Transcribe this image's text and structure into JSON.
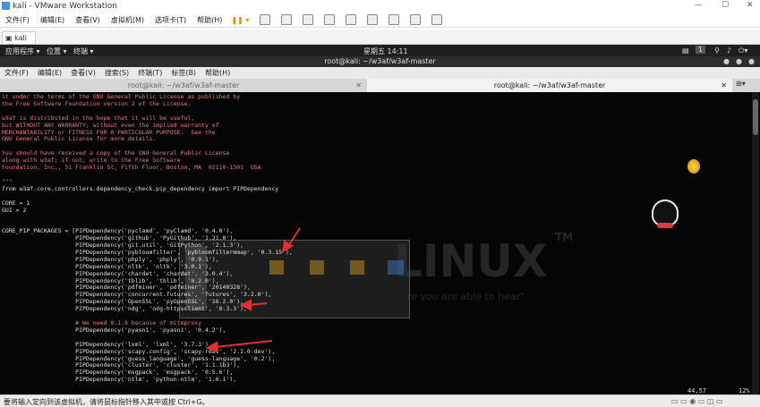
{
  "app": {
    "title": "kali - VMware Workstation"
  },
  "menubar": [
    "文件(F)",
    "编辑(E)",
    "查看(V)",
    "虚拟机(M)",
    "选项卡(T)",
    "帮助(H)"
  ],
  "tab": {
    "label": "kali"
  },
  "gnome": {
    "apps": "应用程序 ▾",
    "places": "位置 ▾",
    "terminal": "终端 ▾",
    "clock": "星期五 14:11",
    "workspace": "1"
  },
  "terminal": {
    "title": "root@kali: ~/w3af/w3af-master",
    "menu": [
      "文件(F)",
      "编辑(E)",
      "查看(V)",
      "搜索(S)",
      "终端(T)",
      "标签(B)",
      "帮助(H)"
    ],
    "tab1": "root@kali: ~/w3af/w3af-master",
    "tab2": "root@kali: ~/w3af/w3af-master",
    "position": "44,57",
    "percent": "12%"
  },
  "code_lines": [
    "it under the terms of the GNU General Public License as published by",
    "the Free Software Foundation version 2 of the License.",
    "",
    "w3af is distributed in the hope that it will be useful,",
    "but WITHOUT ANY WARRANTY; without even the implied warranty of",
    "MERCHANTABILITY or FITNESS FOR A PARTICULAR PURPOSE.  See the",
    "GNU General Public License for more details.",
    "",
    "You should have received a copy of the GNU General Public License",
    "along with w3af; if not, write to the Free Software",
    "Foundation, Inc., 51 Franklin St, Fifth Floor, Boston, MA  02110-1301  USA",
    "",
    "\"\"\"",
    "from w3af.core.controllers.dependency_check.pip_dependency import PIPDependency",
    "",
    "CORE = 1",
    "GUI = 2",
    "",
    "",
    "CORE_PIP_PACKAGES = [PIPDependency('pyclamd', 'pyClamd', '0.4.0'),",
    "                     PIPDependency('github', 'PyGithub', '1.21.0'),",
    "                     PIPDependency('git.util', 'GitPython', '2.1.3'),",
    "                     PIPDependency('pybloomfilter', 'pybloomfiltermmap', '0.3.15'),",
    "                     PIPDependency('phply', 'phply', '0.9.1'),",
    "                     PIPDependency('nltk', 'nltk', '3.0.1'),",
    "                     PIPDependency('chardet', 'chardet', '3.0.4'),",
    "                     PIPDependency('tblib', 'tblib', '0.2.0'),",
    "                     PIPDependency('pdfminer', 'pdfminer', '20140328'),",
    "                     PIPDependency('concurrent.futures', 'futures', '3.2.0'),",
    "                     PIPDependency('OpenSSL', 'pyOpenSSL', '16.2.0'),",
    "                     PIPDependency('ndg', 'ndg-httpsclient', '0.3.3'),",
    "",
    "                     # We need 0.1.8 because of mitmproxy",
    "                     PIPDependency('pyasn1', 'pyasn1', '0.4.2'),",
    "",
    "                     PIPDependency('lxml', 'lxml', '3.7.3'),",
    "                     PIPDependency('scapy.config', 'scapy-real', '2.2.0-dev'),",
    "                     PIPDependency('guess_language', 'guess-language', '0.2'),",
    "                     PIPDependency('cluster', 'cluster', '1.1.1b3'),",
    "                     PIPDependency('msgpack', 'msgpack', '0.5.6'),",
    "                     PIPDependency('ntlm', 'python-ntlm', '1.0.1'),"
  ],
  "status": "要将输入定向到该虚拟机，请将鼠标指针移入其中或按 Ctrl+G。",
  "watermark": {
    "main": "LINUX",
    "tm": "TM",
    "tagline": "re you are able to hear\""
  },
  "colors": {
    "term_bg": "#050505",
    "code": "#e07a7a",
    "arrow": "#e03030"
  }
}
